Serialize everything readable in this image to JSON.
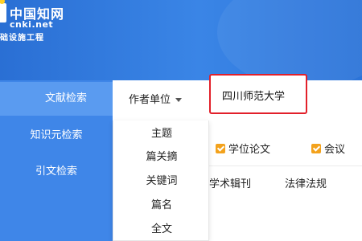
{
  "logo": {
    "name_cn": "中国知网",
    "url": "cnki.net",
    "subtitle": "础设施工程"
  },
  "sidebar": {
    "items": [
      {
        "label": "文献检索",
        "active": true
      },
      {
        "label": "知识元检索",
        "active": false
      },
      {
        "label": "引文检索",
        "active": false
      }
    ]
  },
  "search": {
    "field_label": "作者单位",
    "query": "四川师范大学",
    "highlight_color": "#e2202a"
  },
  "dropdown": {
    "items": [
      "主题",
      "篇关摘",
      "关键词",
      "篇名",
      "全文"
    ]
  },
  "filters": {
    "checkboxes": [
      {
        "label": "学位论文",
        "checked": true
      },
      {
        "label": "会议",
        "checked": true
      }
    ],
    "checkbox_color": "#f3a21c"
  },
  "categories": [
    "学术辑刊",
    "法律法规"
  ],
  "colors": {
    "header_blue": "#2f73d6",
    "sidebar_blue": "#3f86e8",
    "sidebar_active": "#5a9bf0"
  }
}
